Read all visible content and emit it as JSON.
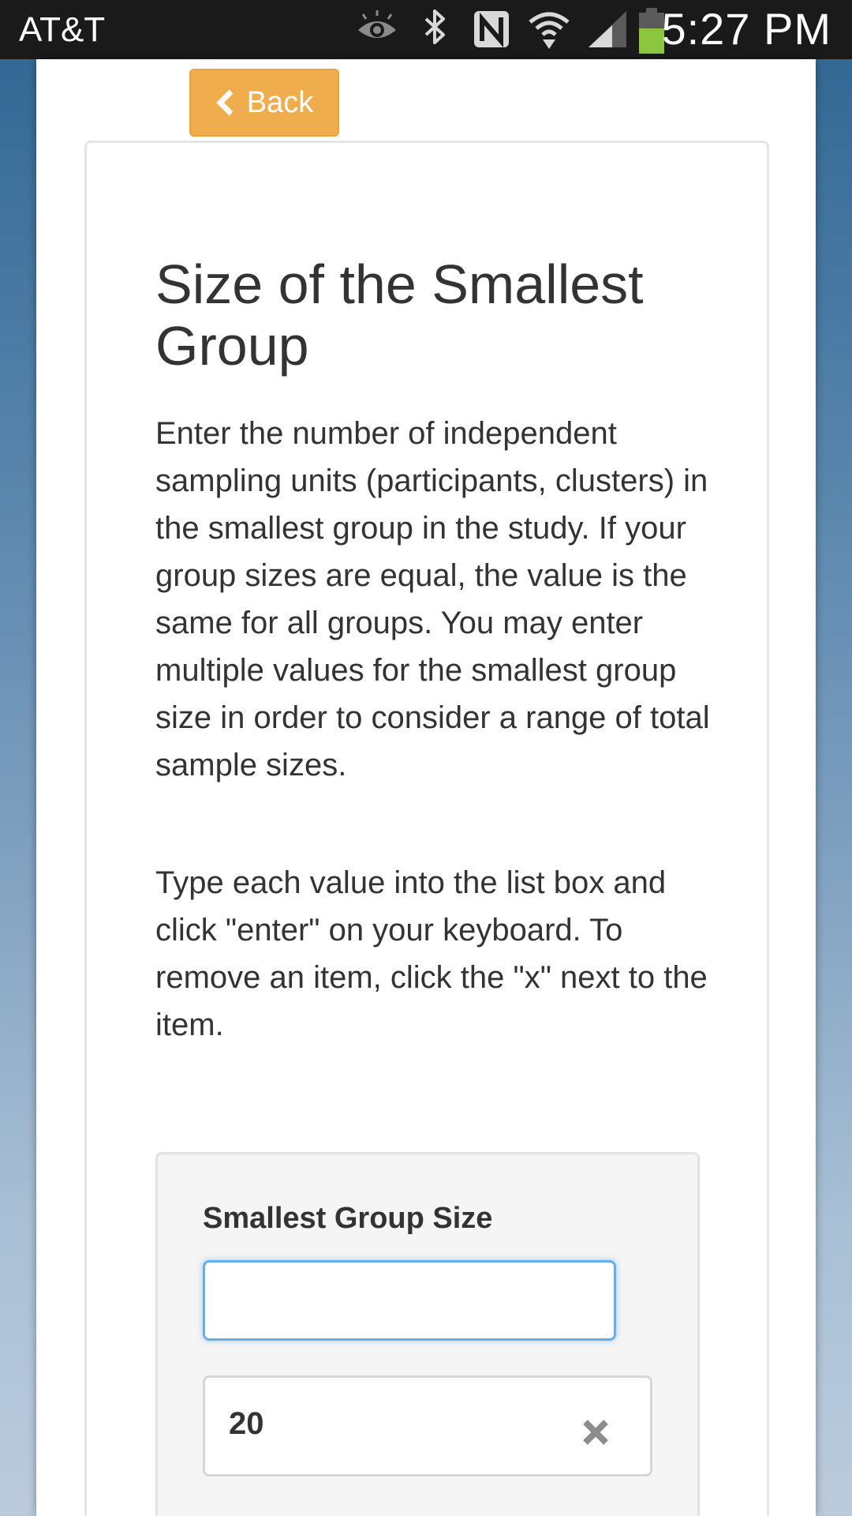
{
  "status_bar": {
    "carrier": "AT&T",
    "time": "5:27 PM",
    "icons": [
      "eye-icon",
      "bluetooth-icon",
      "nfc-icon",
      "wifi-icon",
      "signal-icon",
      "battery-icon"
    ]
  },
  "nav": {
    "back_label": "Back",
    "back_icon": "chevron-left-icon",
    "back_color": "#f0ad4e"
  },
  "content": {
    "title": "Size of the Smallest Group",
    "paragraph1": "Enter the number of independent sampling units (participants, clusters) in the smallest group in the study. If your group sizes are equal, the value is the same for all groups. You may enter multiple values for the smallest group size in order to consider a range of total sample sizes.",
    "paragraph2": "Type each value into the list box and click \"enter\" on your keyboard. To remove an item, click the \"x\" next to the item."
  },
  "form": {
    "label": "Smallest Group Size",
    "input_value": "",
    "items": [
      {
        "value": "20",
        "remove_icon": "remove-x-icon"
      }
    ]
  }
}
